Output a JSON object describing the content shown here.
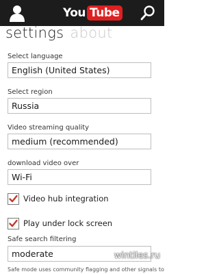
{
  "header": {
    "logo_you": "You",
    "logo_tube": "Tube",
    "icons": {
      "user": "user-icon",
      "search": "search-icon"
    }
  },
  "pivot": {
    "active_tab": "settings",
    "inactive_tab": "about"
  },
  "settings": {
    "language": {
      "label": "Select language",
      "value": "English (United States)"
    },
    "region": {
      "label": "Select region",
      "value": "Russia"
    },
    "streaming": {
      "label": "Video streaming quality",
      "value": "medium (recommended)"
    },
    "download": {
      "label": "download video over",
      "value": "Wi-Fi"
    },
    "video_hub": {
      "label": "Video hub integration",
      "checked": true
    },
    "lock_screen": {
      "label": "Play under lock screen",
      "checked": true
    },
    "safe_search": {
      "label": "Safe search filtering",
      "value": "moderate"
    },
    "footnote": "Safe mode uses community flagging and other signals to"
  },
  "watermark": "wintiles.ru",
  "colors": {
    "accent": "#e02020",
    "checkmark": "#c0392b",
    "topbar": "#1c1c1c"
  }
}
